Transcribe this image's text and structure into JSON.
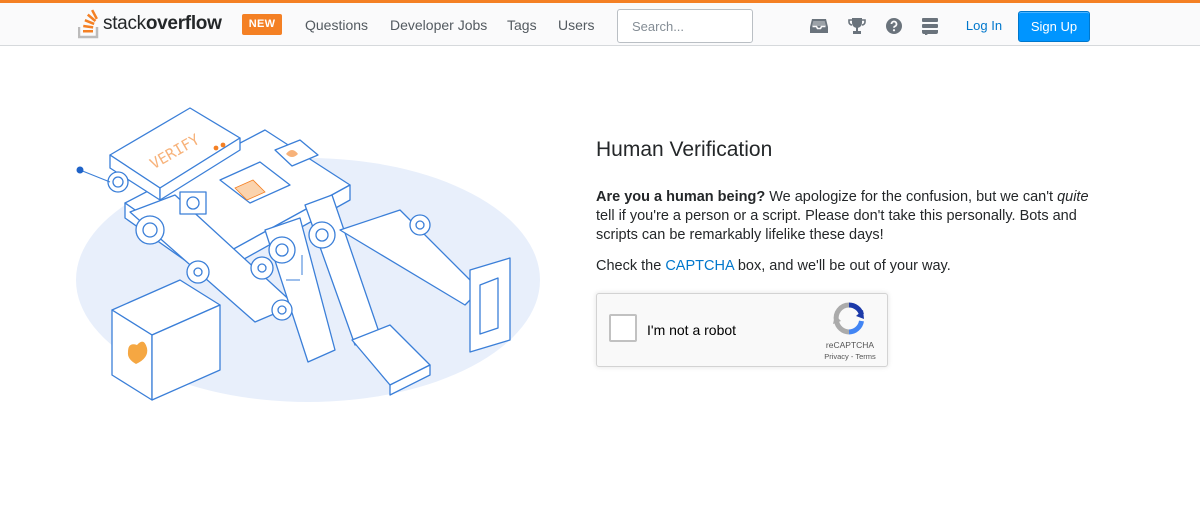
{
  "header": {
    "logo_regular": "stack",
    "logo_bold": "overflow",
    "badge": "NEW",
    "nav": [
      "Questions",
      "Developer Jobs",
      "Tags",
      "Users"
    ],
    "search_placeholder": "Search...",
    "login": "Log In",
    "signup": "Sign Up",
    "tools": [
      "inbox-icon",
      "trophy-icon",
      "help-icon",
      "site-switcher-icon"
    ]
  },
  "illustration": {
    "screen_text": "VERIFY"
  },
  "main": {
    "title": "Human Verification",
    "msg_bold": "Are you a human being?",
    "msg_part1": " We apologize for the confusion, but we can't ",
    "msg_italic": "quite",
    "msg_part2": " tell if you're a person or a script. Please don't take this personally. Bots and scripts can be remarkably lifelike these days!",
    "captcha_prefix": "Check the ",
    "captcha_link": "CAPTCHA",
    "captcha_suffix": " box, and we'll be out of your way."
  },
  "recaptcha": {
    "label": "I'm not a robot",
    "brand": "reCAPTCHA",
    "terms": "Privacy - Terms"
  },
  "colors": {
    "brand_orange": "#f48024",
    "link_blue": "#0077cc",
    "button_blue": "#0095ff",
    "illustration_blue": "#3b7fd8",
    "blob": "#e8effb"
  }
}
